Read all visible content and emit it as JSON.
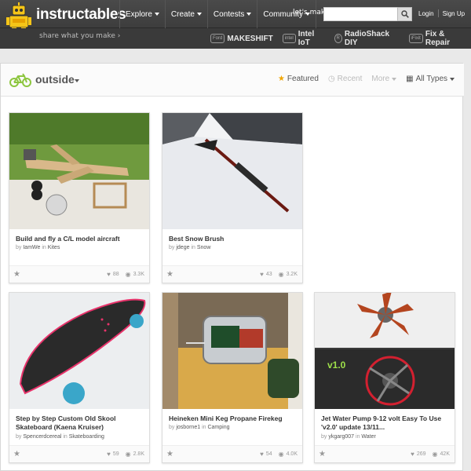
{
  "header": {
    "logo": "instructables",
    "tagline": "share what you make  ›",
    "nav": [
      {
        "label": "Explore"
      },
      {
        "label": "Create"
      },
      {
        "label": "Contests"
      },
      {
        "label": "Community"
      }
    ],
    "lets_make": "let's make",
    "search_placeholder": "",
    "login": "Login",
    "signup": "Sign Up",
    "sponsors": [
      {
        "badge": "Ford",
        "label": "MAKESHIFT"
      },
      {
        "badge": "intel",
        "label": "Intel IoT"
      },
      {
        "badge": "R",
        "label": "RadioShack DIY"
      },
      {
        "badge": "iFixit",
        "label": "Fix & Repair"
      }
    ]
  },
  "category": {
    "title": "outside",
    "icon": "bicycle-icon",
    "filters": {
      "featured": "Featured",
      "recent": "Recent",
      "more": "More",
      "all_types": "All Types"
    }
  },
  "cards": [
    {
      "title": "Build and fly a C/L model aircraft",
      "by": "by",
      "author": "IamWe",
      "in": "in",
      "channel": "Kites",
      "favorites": "88",
      "views": "3.3K"
    },
    {
      "title": "Best Snow Brush",
      "by": "by",
      "author": "jdege",
      "in": "in",
      "channel": "Snow",
      "favorites": "43",
      "views": "3.2K"
    },
    {
      "title": "Step by Step Custom Old Skool Skateboard (Kaena Kruiser)",
      "by": "by",
      "author": "Spencerdcereal",
      "in": "in",
      "channel": "Skateboarding",
      "favorites": "59",
      "views": "2.8K"
    },
    {
      "title": "Heineken Mini Keg Propane Firekeg",
      "by": "by",
      "author": "josborne1",
      "in": "in",
      "channel": "Camping",
      "favorites": "54",
      "views": "4.0K"
    },
    {
      "title": "Jet Water Pump 9-12 volt Easy To Use 'v2.0' update 13/11...",
      "by": "by",
      "author": "ykgarg007",
      "in": "in",
      "channel": "Water",
      "favorites": "269",
      "views": "42K"
    }
  ],
  "colors": {
    "accent_green": "#8dc63f",
    "robot_yellow": "#f5c518",
    "header_dark": "#3a3a3a"
  }
}
